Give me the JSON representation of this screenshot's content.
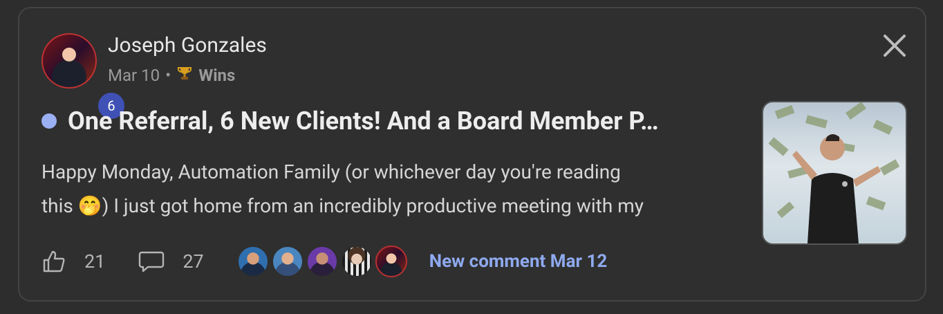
{
  "post": {
    "author": "Joseph Gonzales",
    "level": "6",
    "date": "Mar 10",
    "separator": "•",
    "category": "Wins",
    "category_icon": "trophy-icon",
    "title": "One Referral, 6 New Clients! And a Board Member P…",
    "body_line1": "Happy Monday, Automation Family (or whichever day you're reading",
    "body_line2_start": "this ",
    "emoji": "🤭",
    "body_line2_end": ") I just got home from an incredibly productive meeting with my",
    "likes": "21",
    "comments": "27",
    "new_comment": "New comment Mar 12"
  },
  "colors": {
    "accent": "#8fa9ee",
    "unread_dot": "#9ab0f2",
    "level_badge": "#3f51b5"
  },
  "icons": {
    "close": "close-icon",
    "like": "thumbs-up-icon",
    "comment": "comment-bubble-icon"
  }
}
